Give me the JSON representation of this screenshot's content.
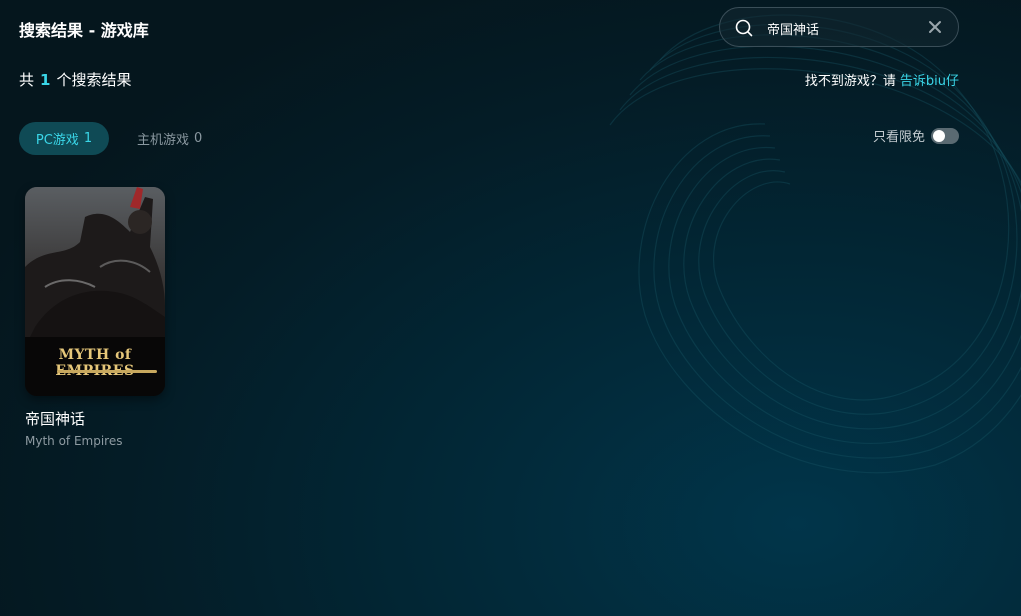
{
  "header": {
    "title": "搜索结果 - 游戏库"
  },
  "search": {
    "value": "帝国神话",
    "icon": "search-icon",
    "clear_icon": "close-icon"
  },
  "results": {
    "prefix": "共",
    "count": "1",
    "suffix": "个搜索结果"
  },
  "help": {
    "text": "找不到游戏？请",
    "link": "告诉biu仔"
  },
  "tabs": [
    {
      "label": "PC游戏",
      "count": "1",
      "active": true
    },
    {
      "label": "主机游戏",
      "count": "0",
      "active": false
    }
  ],
  "filter": {
    "label": "只看限免",
    "enabled": false
  },
  "games": [
    {
      "title": "帝国神话",
      "subtitle": "Myth of Empires",
      "cover_logo": "MYTH of EMPIRES"
    }
  ],
  "colors": {
    "accent": "#3ad6e8",
    "active_tab_bg": "#0f4a55",
    "background": "#022634"
  }
}
